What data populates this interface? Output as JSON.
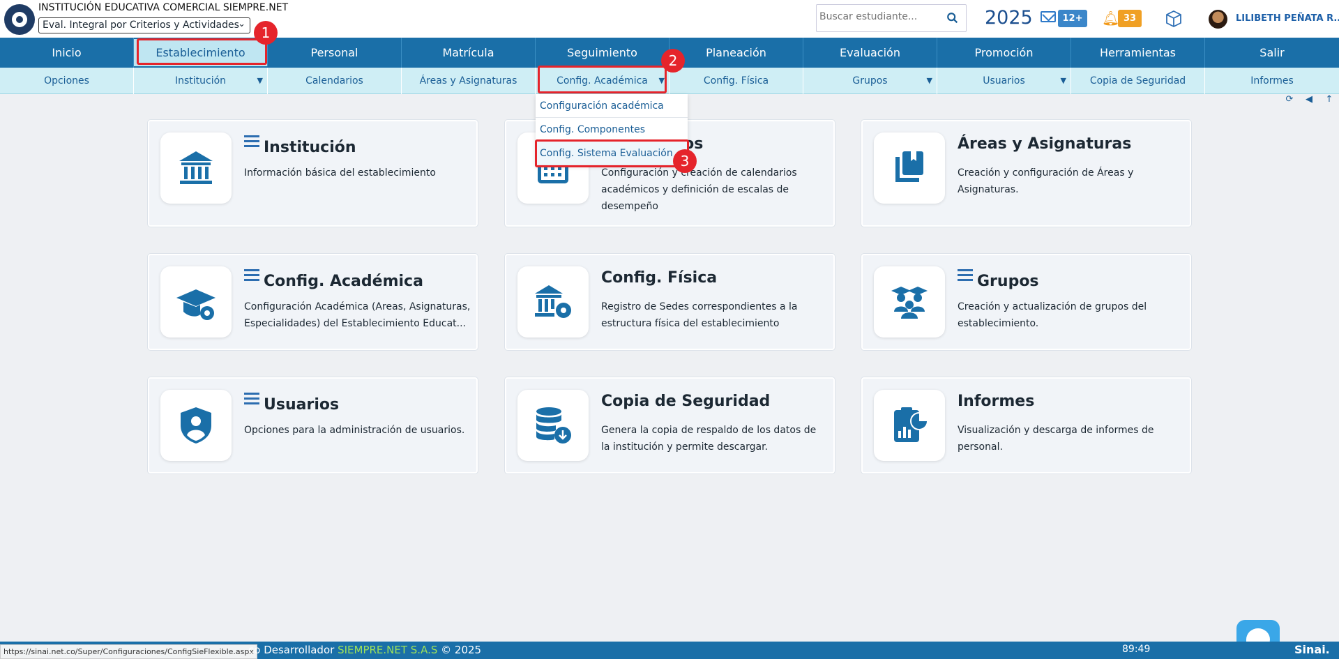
{
  "header": {
    "institution_name": "INSTITUCIÓN EDUCATIVA COMERCIAL SIEMPRE.NET",
    "eval_mode_selected": "Eval. Integral por Criterios y Actividades",
    "search_placeholder": "Buscar estudiante...",
    "year": "2025",
    "messages_count": "12+",
    "notifications_count": "33",
    "user_name": "LILIBETH PEÑATA R..."
  },
  "main_nav": [
    "Inicio",
    "Establecimiento",
    "Personal",
    "Matrícula",
    "Seguimiento",
    "Planeación",
    "Evaluación",
    "Promoción",
    "Herramientas",
    "Salir"
  ],
  "sub_nav": [
    "Opciones",
    "Institución",
    "Calendarios",
    "Áreas y Asignaturas",
    "Config. Académica",
    "Config. Física",
    "Grupos",
    "Usuarios",
    "Copia de Seguridad",
    "Informes"
  ],
  "dropdown": [
    "Configuración académica",
    "Config. Componentes",
    "Config. Sistema Evaluación"
  ],
  "markers": [
    "1",
    "2",
    "3"
  ],
  "cards": [
    {
      "title": "Institución",
      "desc": "Información básica del establecimiento",
      "icon": "institution-icon"
    },
    {
      "title": "Calendarios",
      "desc": "Configuración y creación de calendarios académicos y definición de escalas de desempeño",
      "icon": "calendar-icon"
    },
    {
      "title": "Áreas y Asignaturas",
      "desc": "Creación y configuración de Áreas y Asignaturas.",
      "icon": "books-icon"
    },
    {
      "title": "Config. Académica",
      "desc": "Configuración Académica (Areas, Asignaturas, Especialidades) del Establecimiento Educat...",
      "icon": "graduation-gear-icon"
    },
    {
      "title": "Config. Física",
      "desc": "Registro de Sedes correspondientes a la estructura física del establecimiento",
      "icon": "building-gear-icon"
    },
    {
      "title": "Grupos",
      "desc": "Creación y actualización de grupos del establecimiento.",
      "icon": "students-group-icon"
    },
    {
      "title": "Usuarios",
      "desc": "Opciones para la administración de usuarios.",
      "icon": "user-shield-icon"
    },
    {
      "title": "Copia de Seguridad",
      "desc": "Genera la copia de respaldo de los datos de la institución y permite descargar.",
      "icon": "database-download-icon"
    },
    {
      "title": "Informes",
      "desc": "Visualización y descarga de informes de personal.",
      "icon": "report-chart-icon"
    }
  ],
  "footer": {
    "status_url": "https://sinai.net.co/Super/Configuraciones/ConfigSieFlexible.aspx",
    "dev_prefix": "co Desarrollador",
    "dev_brand": "SIEMPRE.NET S.A.S",
    "copyright": "© 2025",
    "timer": "89:49",
    "brand": "Sinai."
  },
  "colors": {
    "nav_blue": "#1a6fa8",
    "subnav": "#cfeef5",
    "highlight_red": "#e5242b",
    "icon_blue": "#2c6db0"
  }
}
